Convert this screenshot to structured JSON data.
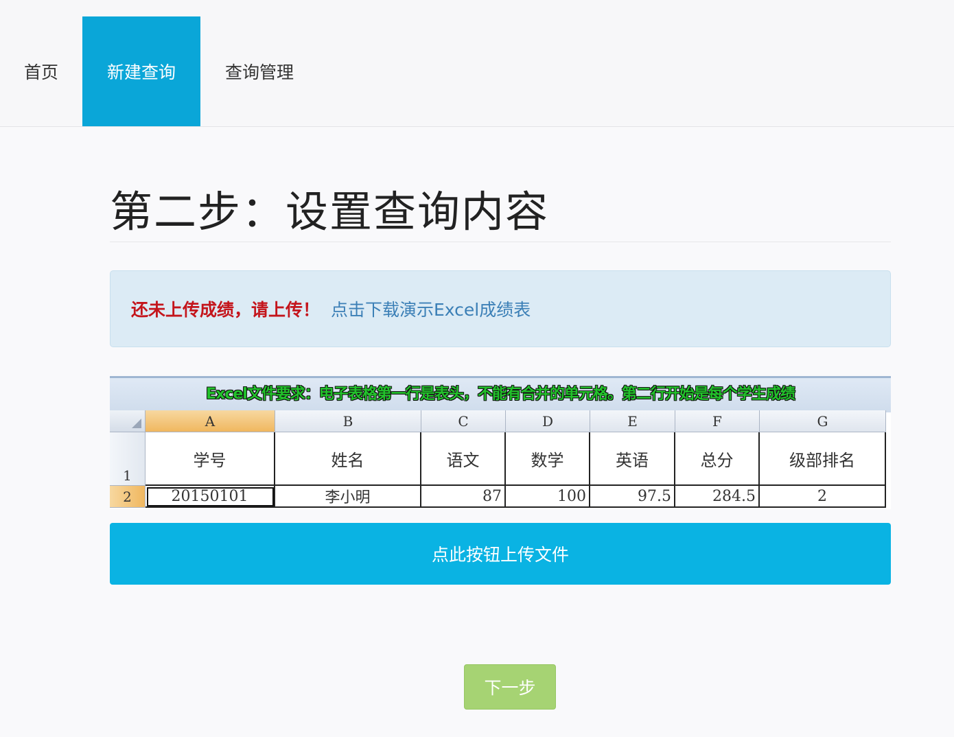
{
  "nav": {
    "items": [
      {
        "label": "首页"
      },
      {
        "label": "新建查询"
      },
      {
        "label": "查询管理"
      }
    ],
    "active_index": 1
  },
  "page": {
    "title": "第二步：设置查询内容"
  },
  "alert": {
    "warning": "还未上传成绩，请上传！",
    "link": "点击下载演示Excel成绩表"
  },
  "excel_demo": {
    "note": "Excel文件要求：电子表格第一行是表头，不能有合并的单元格。第二行开始是每个学生成绩",
    "columns": [
      "A",
      "B",
      "C",
      "D",
      "E",
      "F",
      "G"
    ],
    "row_numbers": [
      "1",
      "2"
    ],
    "header_row": [
      "学号",
      "姓名",
      "语文",
      "数学",
      "英语",
      "总分",
      "级部排名"
    ],
    "data_row": [
      "20150101",
      "李小明",
      "87",
      "100",
      "97.5",
      "284.5",
      "2"
    ]
  },
  "buttons": {
    "upload": "点此按钮上传文件",
    "next": "下一步"
  },
  "colors": {
    "nav_active": "#0aa6d8",
    "upload_button": "#0ab3e3",
    "next_button": "#a6d373",
    "warning_text": "#c4151c",
    "link_text": "#3b7fb6"
  }
}
